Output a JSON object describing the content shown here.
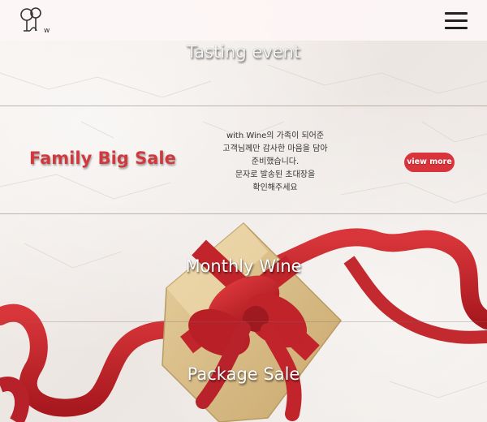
{
  "header": {
    "logo_text": "w",
    "menu_icon": "hamburger-icon"
  },
  "sections": {
    "tasting": "Tasting event",
    "family": {
      "title": "Family Big Sale",
      "description": [
        "with Wine의 가족이 되어준",
        "고객님께만 감사한 마음을 담아",
        "준비했습니다.",
        "문자로 발송된 초대장을",
        "확인해주세요"
      ],
      "button": "view more"
    },
    "monthly": "Monthly Wine",
    "package": "Package Sale"
  },
  "colors": {
    "accent": "#d9343b",
    "sale_title": "#cf3a3f",
    "ribbon": "#c8262c",
    "box": "#d9bf8c",
    "header_bg": "#fdf6f5"
  }
}
